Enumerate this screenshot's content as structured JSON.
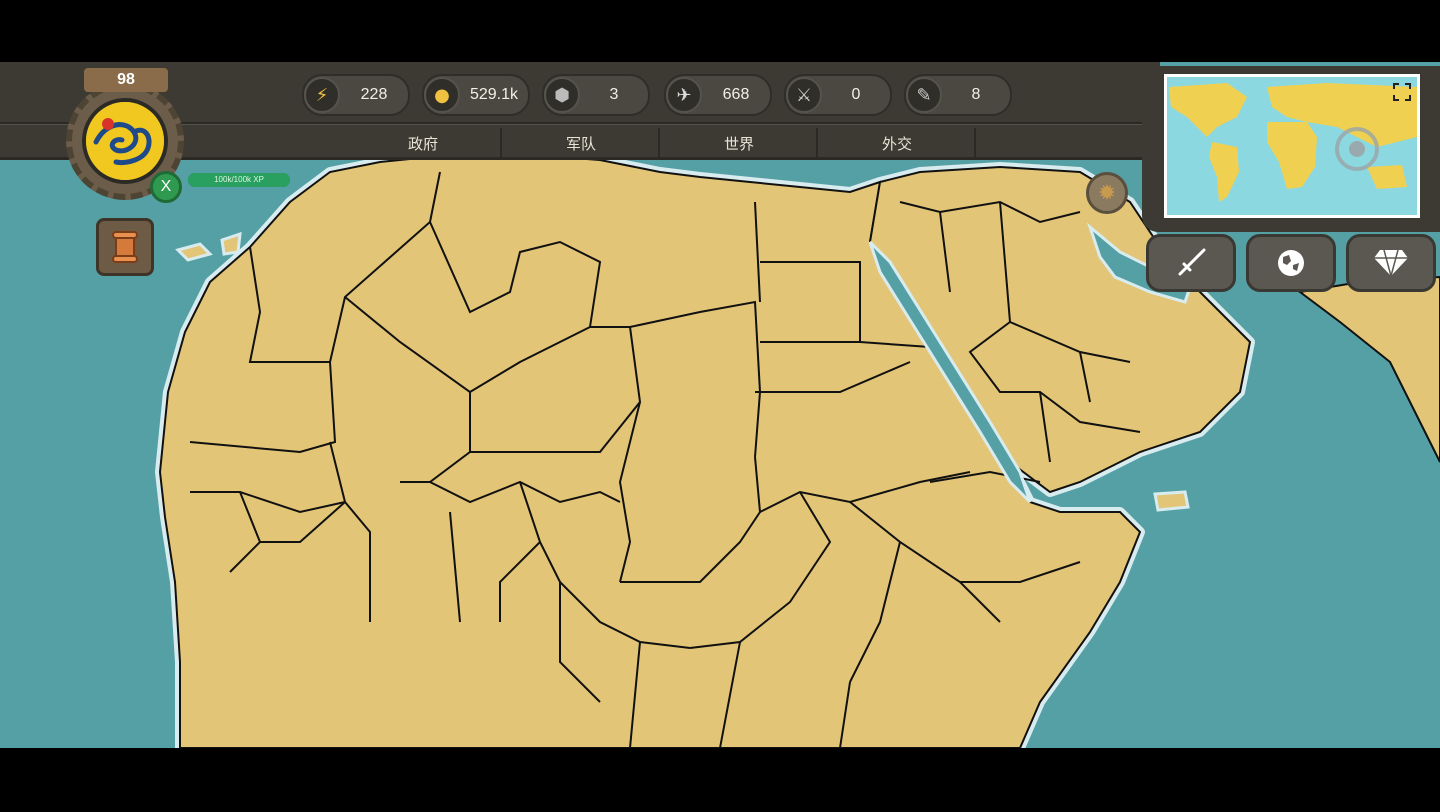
{
  "player": {
    "level": "98",
    "xp_text": "100k/100k XP",
    "xp_progress": 1.0,
    "badge_label": "X"
  },
  "resources": [
    {
      "name": "energy",
      "icon": "lightning-icon",
      "value": "228"
    },
    {
      "name": "gold",
      "icon": "gold-coins-icon",
      "value": "529.1k"
    },
    {
      "name": "manpower",
      "icon": "shield-icon",
      "value": "3"
    },
    {
      "name": "oil",
      "icon": "oil-drop-icon",
      "value": "668"
    },
    {
      "name": "army",
      "icon": "crossed-swords-icon",
      "value": "0"
    },
    {
      "name": "research",
      "icon": "pen-icon",
      "value": "8"
    }
  ],
  "tabs": [
    {
      "label": "政府"
    },
    {
      "label": "军队"
    },
    {
      "label": "世界"
    },
    {
      "label": "外交"
    }
  ],
  "colors": {
    "land": "#e3c577",
    "sea": "#55a0a5",
    "border": "#111111",
    "coast_glow": "#d8ecf0",
    "ui_dark": "#3c3a33"
  },
  "side_buttons": [
    {
      "name": "war-button",
      "icon": "sword-icon"
    },
    {
      "name": "world-button",
      "icon": "globe-icon"
    },
    {
      "name": "premium-button",
      "icon": "diamond-icon"
    }
  ]
}
